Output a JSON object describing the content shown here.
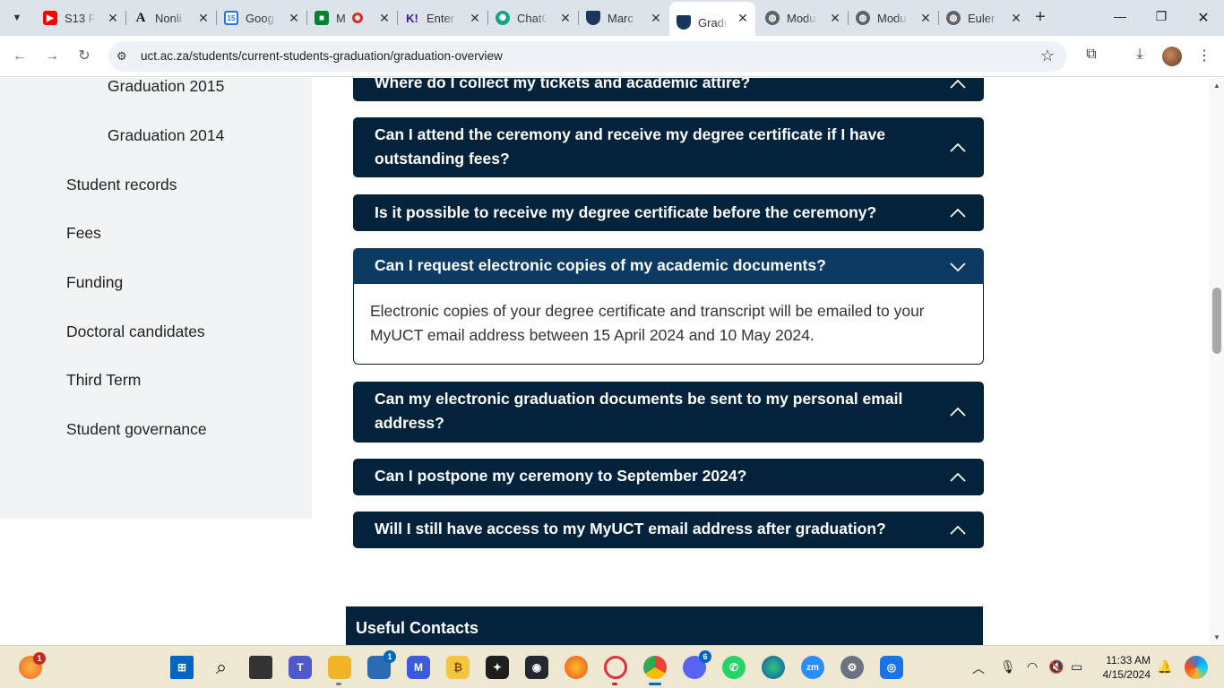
{
  "browser": {
    "tabs": [
      {
        "title": "S13 R",
        "icon": "youtube-icon",
        "color": "#ff0000"
      },
      {
        "title": "Nonli",
        "icon": "a-letter-icon",
        "color": "#111111"
      },
      {
        "title": "Goog",
        "icon": "calendar-icon",
        "color": "#1a73e8"
      },
      {
        "title": "M",
        "icon": "meet-icon",
        "color": "#00832d"
      },
      {
        "title": "Enter",
        "icon": "kahoot-icon",
        "color": "#46178f"
      },
      {
        "title": "ChatG",
        "icon": "chatgpt-icon",
        "color": "#10a37f"
      },
      {
        "title": "Marc",
        "icon": "uct-shield-icon",
        "color": "#1b365d"
      },
      {
        "title": "Gradu",
        "icon": "uct-shield-icon",
        "color": "#1b365d",
        "active": true
      },
      {
        "title": "Modu",
        "icon": "globe-icon",
        "color": "#5f6368"
      },
      {
        "title": "Modu",
        "icon": "globe-icon",
        "color": "#5f6368"
      },
      {
        "title": "Euler",
        "icon": "globe-icon",
        "color": "#5f6368"
      }
    ],
    "url": "uct.ac.za/students/current-students-graduation/graduation-overview"
  },
  "sidebar": {
    "sub_items": [
      "Graduation 2015",
      "Graduation 2014"
    ],
    "items": [
      "Student records",
      "Fees",
      "Funding",
      "Doctoral candidates",
      "Third Term",
      "Student governance"
    ]
  },
  "faq": [
    {
      "question": "Where do I collect my tickets and academic attire?"
    },
    {
      "question": "Can I attend the ceremony and receive my degree certificate if I have outstanding fees?"
    },
    {
      "question": "Is it possible to receive my degree certificate before the ceremony?"
    },
    {
      "question": "Can I request electronic copies of my academic documents?",
      "open": true,
      "answer": "Electronic copies of your degree certificate and transcript will be emailed to your MyUCT email address between 15 April 2024 and 10 May 2024."
    },
    {
      "question": "Can my electronic graduation documents be sent to my personal email address?"
    },
    {
      "question": "Can I postpone my ceremony to September 2024?"
    },
    {
      "question": "Will I still have access to my MyUCT email address after graduation?"
    }
  ],
  "contacts": {
    "heading": "Useful Contacts"
  },
  "taskbar": {
    "notification_count": "1",
    "store_badge": "1",
    "discord_badge": "6",
    "time": "11:33 AM",
    "date": "4/15/2024"
  },
  "colors": {
    "accordion": "#03223c",
    "accordion_open": "#0c3a63",
    "sidebar_bg": "#f2f3f5"
  }
}
